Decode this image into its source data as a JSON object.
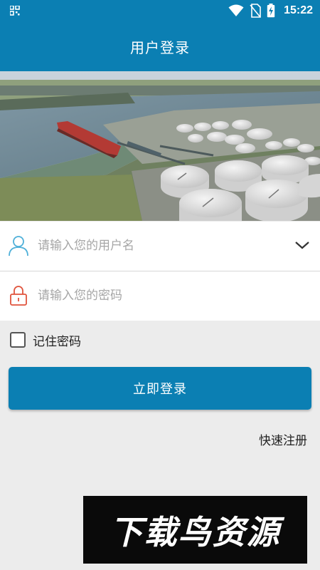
{
  "status_bar": {
    "time": "15:22",
    "icons": [
      "qr-grid-icon",
      "wifi-icon",
      "no-sim-icon",
      "battery-charging-icon"
    ]
  },
  "header": {
    "title": "用户登录"
  },
  "banner": {
    "description_icon": "port-tanker-photo"
  },
  "form": {
    "username_placeholder": "请输入您的用户名",
    "password_placeholder": "请输入您的密码",
    "remember_label": "记住密码",
    "remember_checked": false,
    "login_label": "立即登录",
    "register_label": "快速注册"
  },
  "watermark": {
    "text": "下载鸟资源"
  },
  "colors": {
    "primary": "#0b7fb3",
    "user_icon": "#4fb0d9",
    "lock_icon": "#e0533c",
    "background": "#ececec"
  }
}
